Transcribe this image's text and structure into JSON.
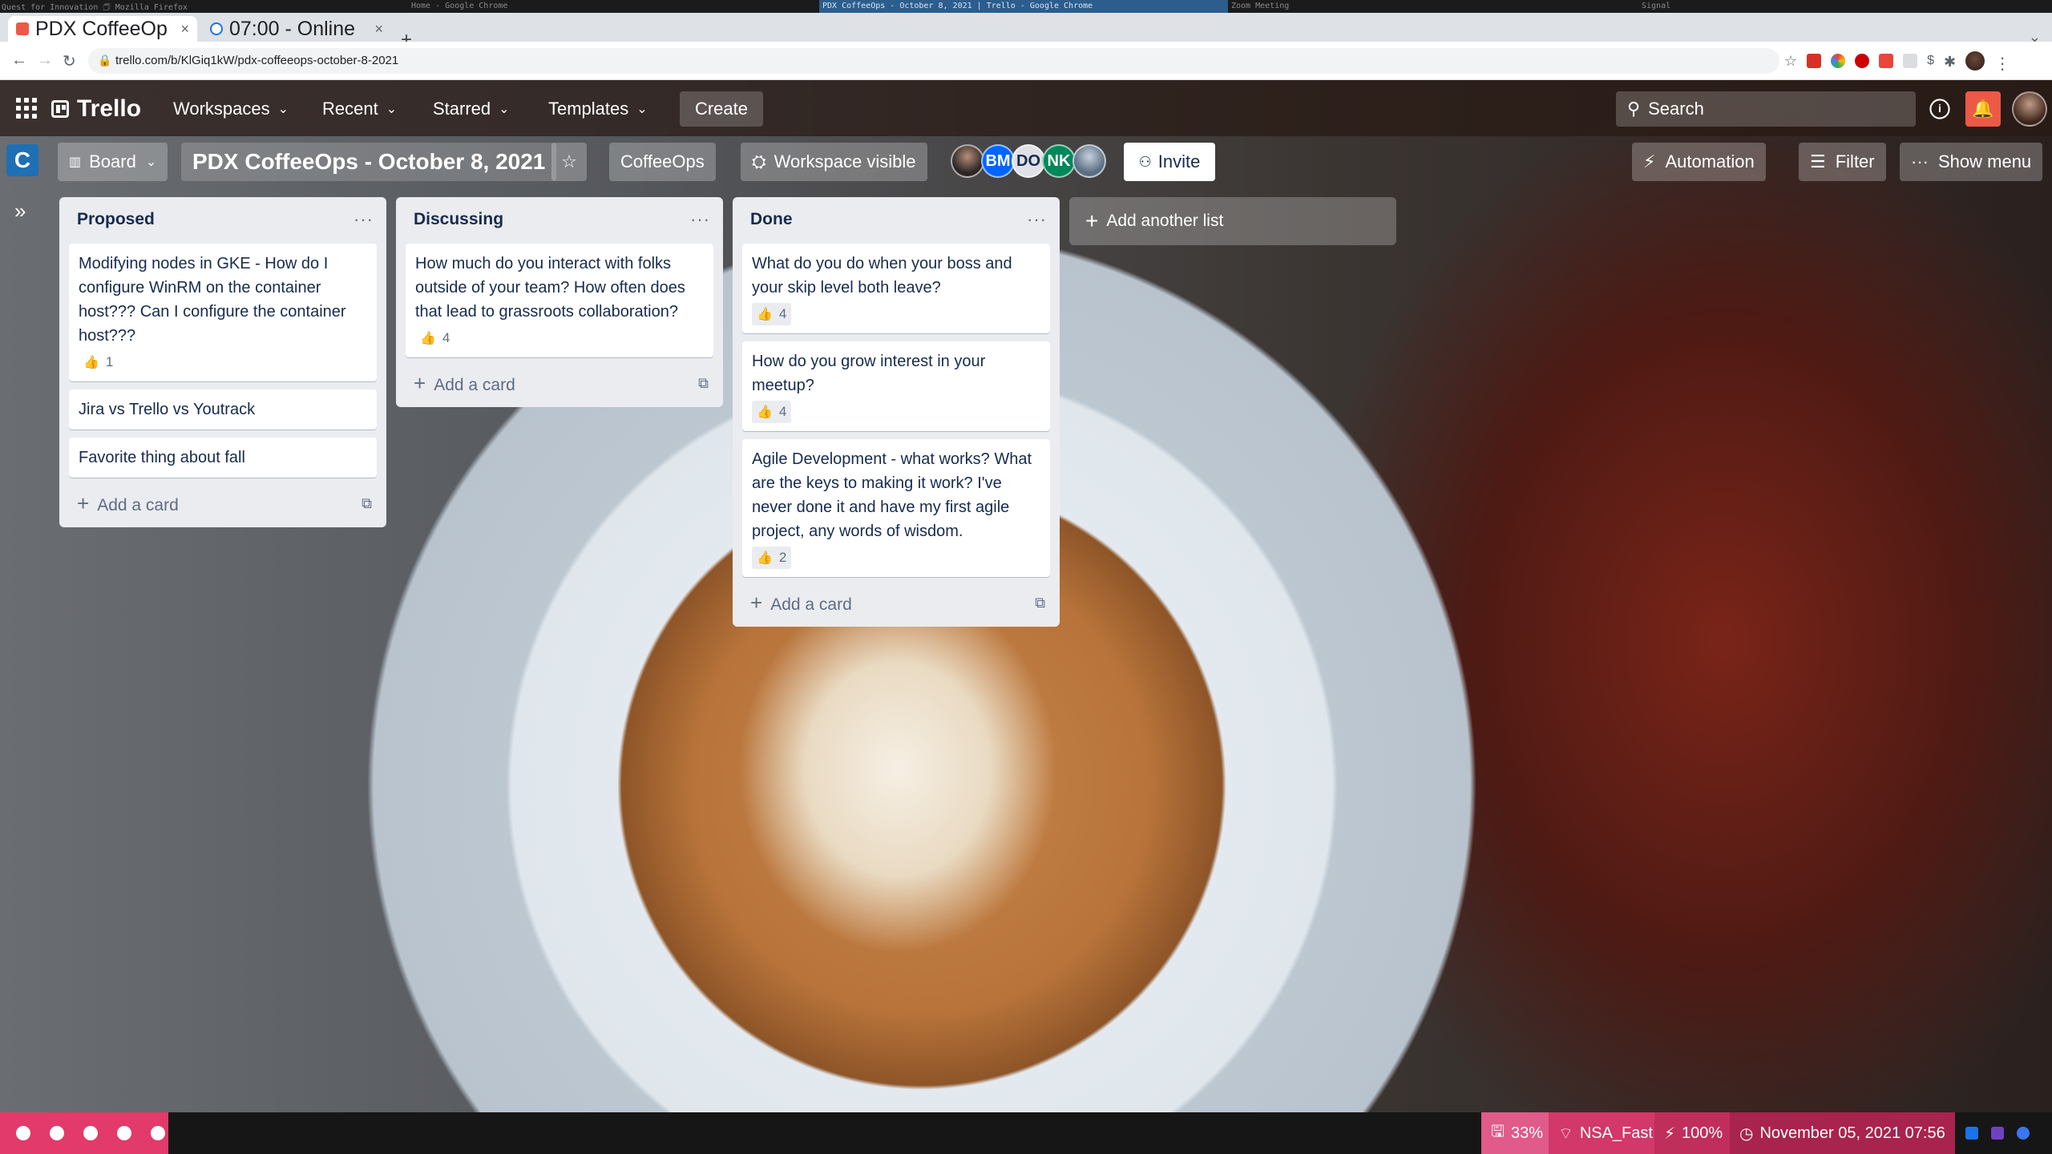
{
  "wm": {
    "titles": [
      "Quest for Innovation 🗇 Mozilla Firefox",
      "Home - Google Chrome",
      "PDX CoffeeOps - October 8, 2021 | Trello - Google Chrome",
      "Zoom Meeting",
      "Signal"
    ]
  },
  "browser": {
    "tabs": [
      {
        "label": "PDX CoffeeOp",
        "close": "×"
      },
      {
        "label": "07:00 - Online",
        "close": "×"
      }
    ],
    "new_tab": "+",
    "url": "trello.com/b/KlGiq1kW/pdx-coffeeops-october-8-2021"
  },
  "trello_header": {
    "logo": "Trello",
    "workspaces": "Workspaces",
    "recent": "Recent",
    "starred": "Starred",
    "templates": "Templates",
    "create": "Create",
    "search_placeholder": "Search"
  },
  "board": {
    "workspace_initial": "C",
    "view": "Board",
    "title": "PDX CoffeeOps - October 8, 2021",
    "workspace_name": "CoffeeOps",
    "visibility": "Workspace visible",
    "members": [
      {
        "initials": "",
        "color": "#3b3a3a"
      },
      {
        "initials": "BM",
        "color": "#0065ff"
      },
      {
        "initials": "DO",
        "color": "#dfe1e6"
      },
      {
        "initials": "NK",
        "color": "#00875a"
      },
      {
        "initials": "",
        "color": "#6b7c8f"
      }
    ],
    "invite": "Invite",
    "automation": "Automation",
    "filter": "Filter",
    "show_menu": "Show menu",
    "add_list": "Add another list"
  },
  "lists": [
    {
      "title": "Proposed",
      "cards": [
        {
          "text": "Modifying nodes in GKE - How do I configure WinRM on the container host??? Can I configure the container host???",
          "votes": "1"
        },
        {
          "text": "Jira vs Trello vs Youtrack",
          "votes": ""
        },
        {
          "text": "Favorite thing about fall",
          "votes": ""
        }
      ],
      "add_card": "Add a card"
    },
    {
      "title": "Discussing",
      "cards": [
        {
          "text": "How much do you interact with folks outside of your team? How often does that lead to grassroots collaboration?",
          "votes": "4"
        }
      ],
      "add_card": "Add a card"
    },
    {
      "title": "Done",
      "cards": [
        {
          "text": "What do you do when your boss and your skip level both leave?",
          "votes": "4"
        },
        {
          "text": "How do you grow interest in your meetup?",
          "votes": "4"
        },
        {
          "text": "Agile Development - what works? What are the keys to making it work? I've never done it and have my first agile project, any words of wisdom.",
          "votes": "2"
        }
      ],
      "add_card": "Add a card"
    }
  ],
  "status_bar": {
    "disk": "33%",
    "wifi": "NSA_Fast",
    "battery": "100%",
    "datetime": "November 05, 2021 07:56"
  },
  "colors": {
    "trello_blue": "#1f6fb4",
    "notification_red": "#eb5a46",
    "workspace_pink": "#e23a6a",
    "list_bg": "#ebecf0"
  }
}
